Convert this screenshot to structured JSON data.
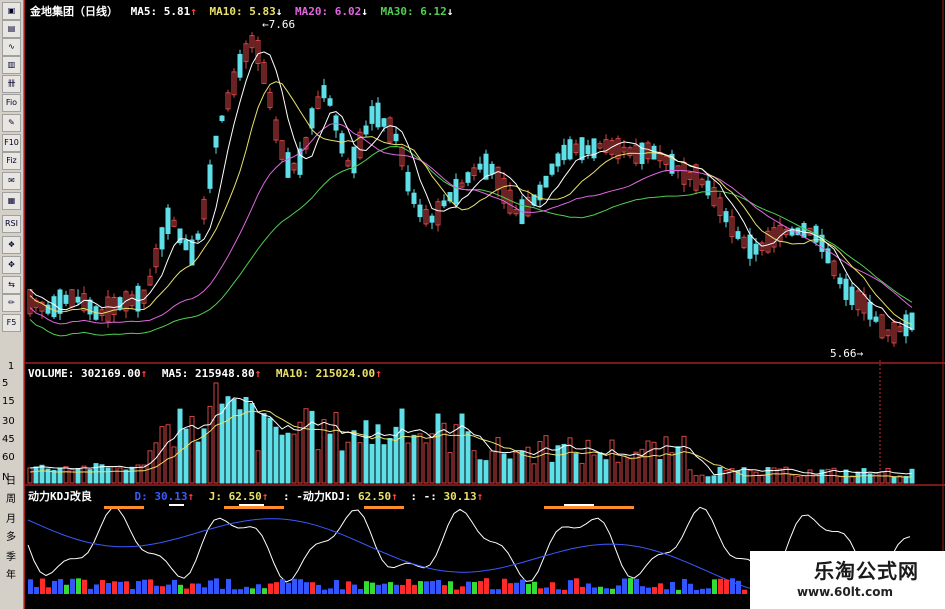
{
  "header": {
    "stock": "金地集团（日线）",
    "ma5_label": "MA5: ",
    "ma5": "5.81",
    "ma5_arrow": "↑",
    "ma10_label": "MA10: ",
    "ma10": "5.83",
    "ma10_arrow": "↓",
    "ma20_label": "MA20: ",
    "ma20": "6.02",
    "ma20_arrow": "↓",
    "ma30_label": "MA30: ",
    "ma30": "6.12",
    "ma30_arrow": "↓"
  },
  "annotations": {
    "high": "7.66",
    "low": "5.66"
  },
  "volume": {
    "label": "VOLUME: ",
    "value": "302169.00",
    "arrow": "↑",
    "ma5_label": "MA5: ",
    "ma5": "215948.80",
    "ma5_arrow": "↑",
    "ma10_label": "MA10: ",
    "ma10": "215024.00",
    "ma10_arrow": "↑"
  },
  "kdj": {
    "name": "动力KDJ改良",
    "d_label": "D: ",
    "d": "30.13",
    "d_arrow": "↑",
    "j_label": "J: ",
    "j": "62.50",
    "j_arrow": "↑",
    "dk_label": ": -动力KDJ: ",
    "dk": "62.50",
    "dk_arrow": "↑",
    "tail_label": ": -: ",
    "tail": "30.13",
    "tail_arrow": "↑"
  },
  "volume_axis": [
    "5",
    "15",
    "30",
    "45",
    "60",
    "N"
  ],
  "toolbar": {
    "buttons": [
      "▣",
      "▤",
      "∿",
      "▥",
      "卌",
      "Fio",
      "✎",
      "F10",
      "Fiz",
      "✉",
      "▦",
      "RSI",
      "❖",
      "✥",
      "⇆",
      "✏",
      "F5"
    ],
    "top_number": "1",
    "periods": [
      "日",
      "周",
      "月",
      "多",
      "季",
      "年"
    ]
  },
  "watermark": {
    "title": "乐淘公式网",
    "url": "www.60lt.com"
  },
  "colors": {
    "up": "#d64545",
    "down": "#5fe0e8",
    "ma5": "#ffffff",
    "ma10": "#e8e06a",
    "ma20": "#e066e0",
    "ma30": "#4fcf4f",
    "kdj_k": "#ffffff",
    "kdj_d": "#3a5aff",
    "divider": "#a02020"
  }
}
